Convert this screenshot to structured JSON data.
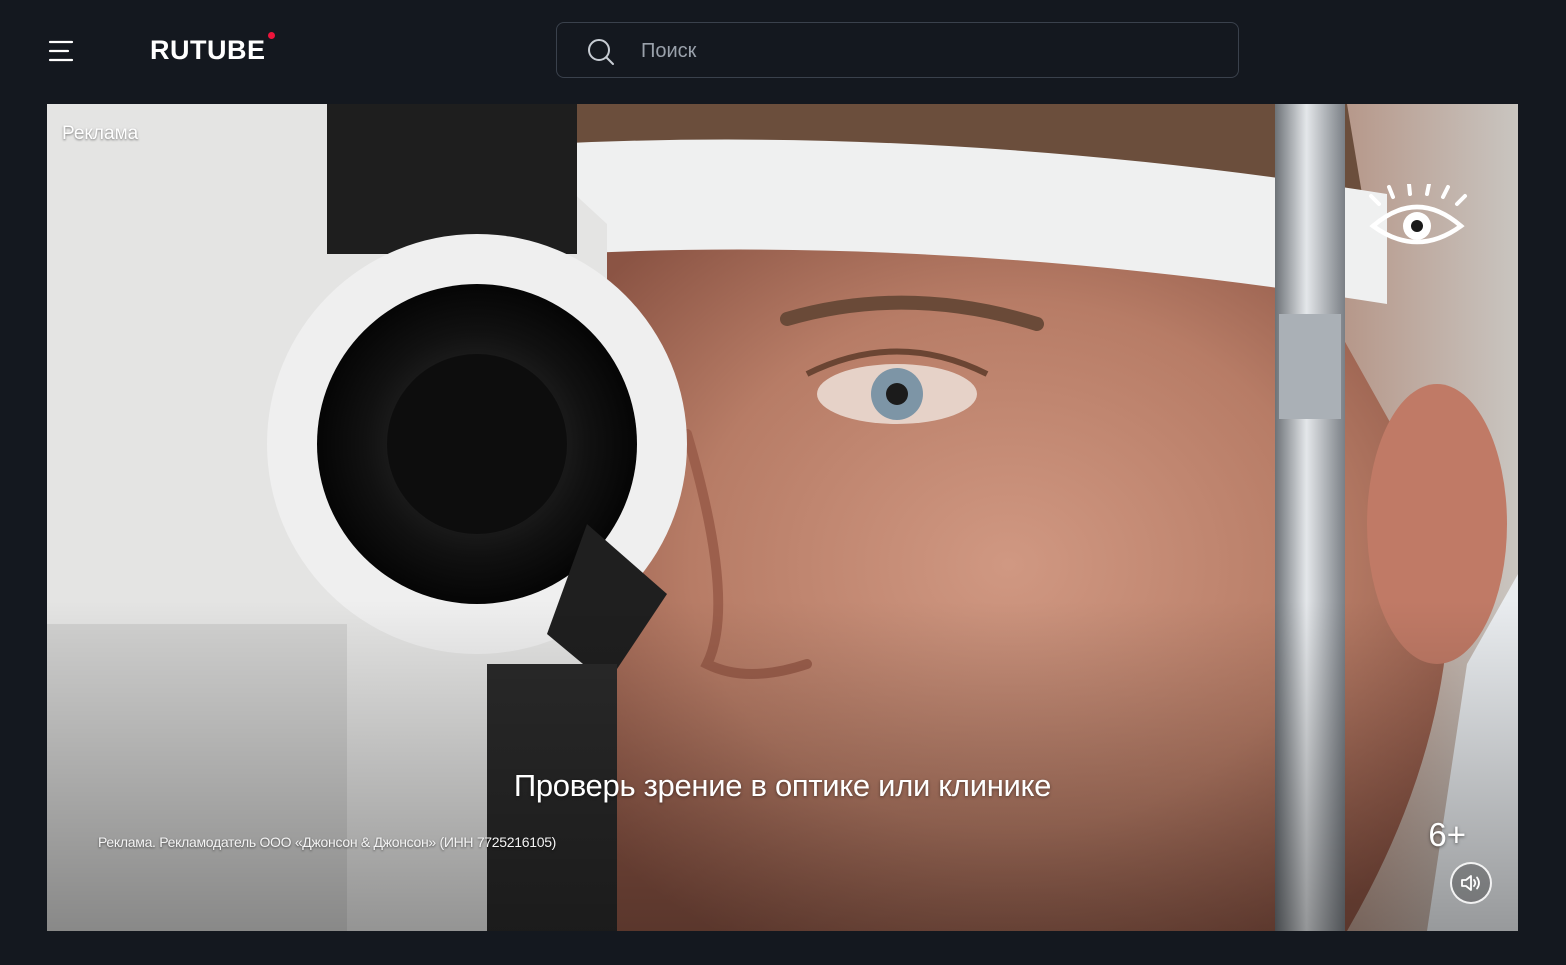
{
  "header": {
    "logo_text": "RUTUBE",
    "search": {
      "placeholder": "Поиск",
      "value": ""
    },
    "icons": {
      "menu": "hamburger-menu-icon",
      "search": "search-icon"
    },
    "accent_color": "#ed143b"
  },
  "player": {
    "ad_label": "Реклама",
    "caption": "Проверь зрение в оптике или клинике",
    "disclaimer": "Реклама. Рекламодатель ООО «Джонсон & Джонсон» (ИНН 7725216105)",
    "age_rating": "6+",
    "icons": {
      "brand": "eye-logo-icon",
      "sound": "speaker-icon"
    }
  }
}
